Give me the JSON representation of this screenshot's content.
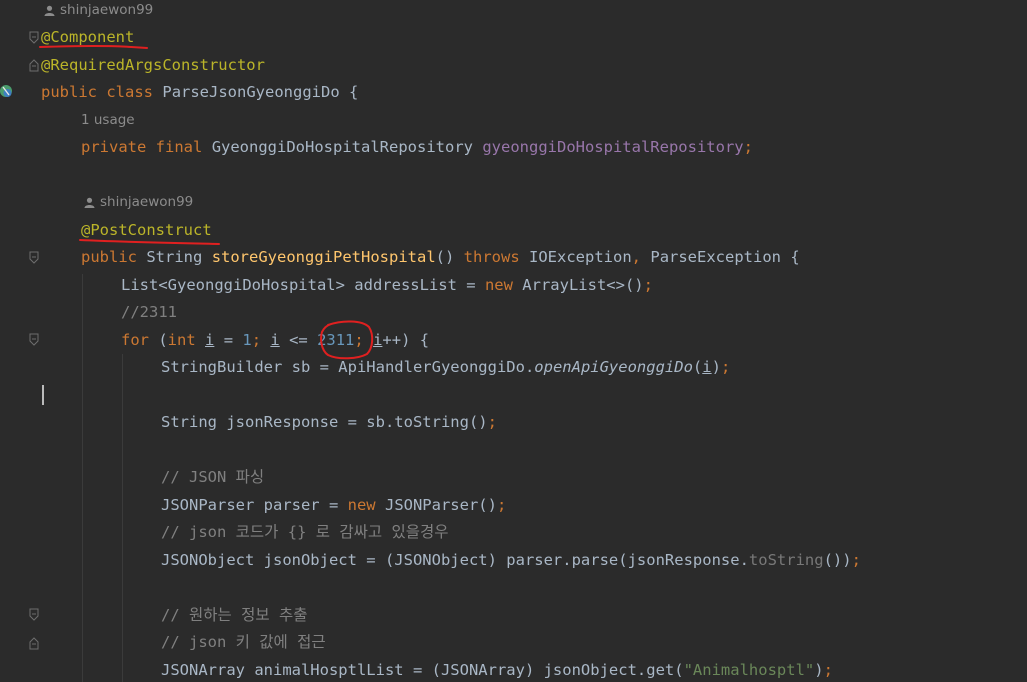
{
  "editor": {
    "author_hint_1": "shinjaewon99",
    "annotation_component": "@Component",
    "annotation_required_args": "@RequiredArgsConstructor",
    "class_public": "public",
    "class_class": "class",
    "class_name": "ParseJsonGyeonggiDo",
    "brace_open": "{",
    "usage_hint": "1 usage",
    "field_private": "private",
    "field_final": "final",
    "field_type": "GyeonggiDoHospitalRepository",
    "field_name": "gyeonggiDoHospitalRepository",
    "semicolon": ";",
    "author_hint_2": "shinjaewon99",
    "annotation_post_construct": "@PostConstruct",
    "method_public": "public",
    "method_return_type": "String",
    "method_name": "storeGyeonggiPetHospital",
    "method_parens": "()",
    "throws_keyword": "throws",
    "exception_1": "IOException",
    "comma": ",",
    "exception_2": "ParseException",
    "list_decl": "List<GyeonggiDoHospital> addressList = ",
    "new_keyword": "new",
    "list_init": "ArrayList<>()",
    "comment_2311": "//2311",
    "for_keyword": "for",
    "for_open": " (",
    "int_keyword": "int",
    "var_i": "i",
    "assign": " = ",
    "num_1": "1",
    "cond_sep": " <= ",
    "num_2311": "2311",
    "incr": "++",
    "for_close": ") {",
    "sb_decl": "StringBuilder sb = ApiHandlerGyeonggiDo.",
    "sb_method": "openApiGyeonggiDo",
    "json_response_line": "String jsonResponse = sb.toString()",
    "comment_json_parse": "// JSON 파싱",
    "parser_decl": "JSONParser parser = ",
    "parser_init": "JSONParser()",
    "comment_json_code": "// json 코드가 {} 로 감싸고 있을경우",
    "jsonobject_decl": "JSONObject jsonObject = (JSONObject) parser.parse(jsonResponse.",
    "tostring_call": "toString",
    "tostring_tail": "())",
    "comment_extract": "// 원하는 정보 추출",
    "comment_access": "// json 키 값에 접근",
    "jsonarray_decl": "JSONArray animalHosptlList = (JSONArray) jsonObject.get(",
    "string_literal": "\"Animalhosptl\"",
    "close_paren": ")"
  },
  "colors": {
    "background": "#2b2b2b",
    "default_text": "#a9b7c6",
    "keyword": "#cc7832",
    "annotation": "#bbb529",
    "number": "#6897bb",
    "comment": "#808080",
    "string": "#6a8759",
    "field": "#9876aa",
    "method_decl": "#ffc66d",
    "hint": "#8c8c8c",
    "markup_red": "#e02020"
  },
  "icons": [
    "person-icon",
    "fold-marker-icon",
    "bean-gutter-icon"
  ]
}
